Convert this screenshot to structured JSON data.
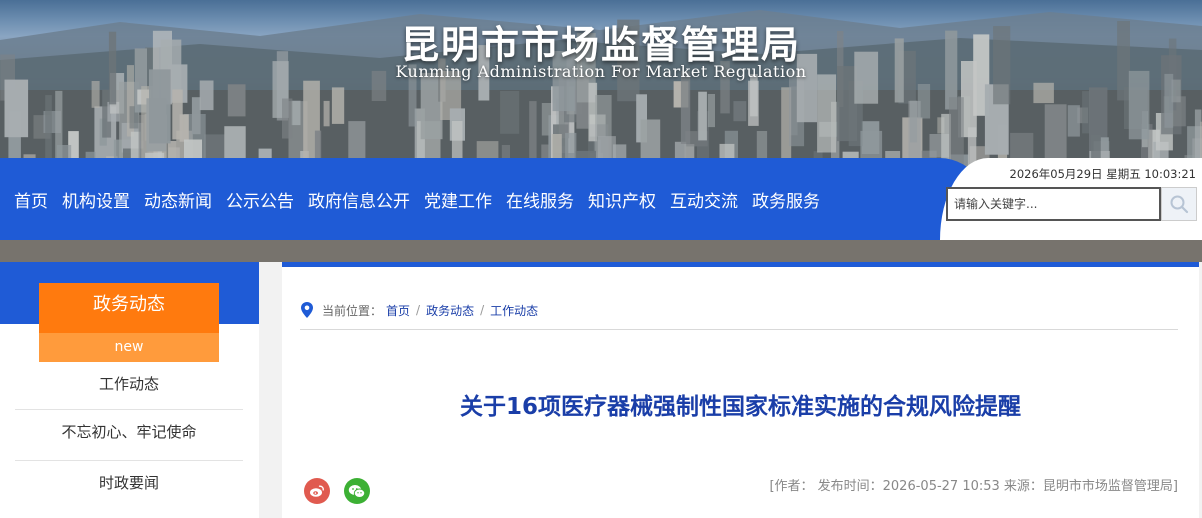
{
  "header": {
    "title": "昆明市市场监督管理局",
    "subtitle": "Kunming Administration For Market Regulation"
  },
  "nav": {
    "items": [
      {
        "label": "首页"
      },
      {
        "label": "机构设置"
      },
      {
        "label": "动态新闻"
      },
      {
        "label": "公示公告"
      },
      {
        "label": "政府信息公开"
      },
      {
        "label": "党建工作"
      },
      {
        "label": "在线服务"
      },
      {
        "label": "知识产权"
      },
      {
        "label": "互动交流"
      },
      {
        "label": "政务服务"
      }
    ],
    "datetime": "2026年05月29日 星期五 10:03:21",
    "search_placeholder": "请输入关键字...",
    "search_icon": "search-icon"
  },
  "sidebar": {
    "category_title": "政务动态",
    "category_tag": "new",
    "items": [
      {
        "label": "工作动态"
      },
      {
        "label": "不忘初心、牢记使命"
      },
      {
        "label": "时政要闻"
      }
    ]
  },
  "breadcrumb": {
    "prefix": "当前位置：",
    "items": [
      "首页",
      "政务动态",
      "工作动态"
    ],
    "separator": "/"
  },
  "article": {
    "title": "关于16项医疗器械强制性国家标准实施的合规风险提醒",
    "meta": "[作者：   发布时间：2026-05-27 10:53 来源：昆明市市场监督管理局]"
  },
  "share": {
    "icons": [
      "weibo-icon",
      "wechat-icon"
    ]
  },
  "colors": {
    "primary_blue": "#1f5bd6",
    "accent_orange": "#ff7a0e",
    "accent_orange_light": "#ff9b3c",
    "title_blue": "#1a3ea8",
    "weibo_red": "#e05a4f",
    "wechat_green": "#3cb034"
  }
}
